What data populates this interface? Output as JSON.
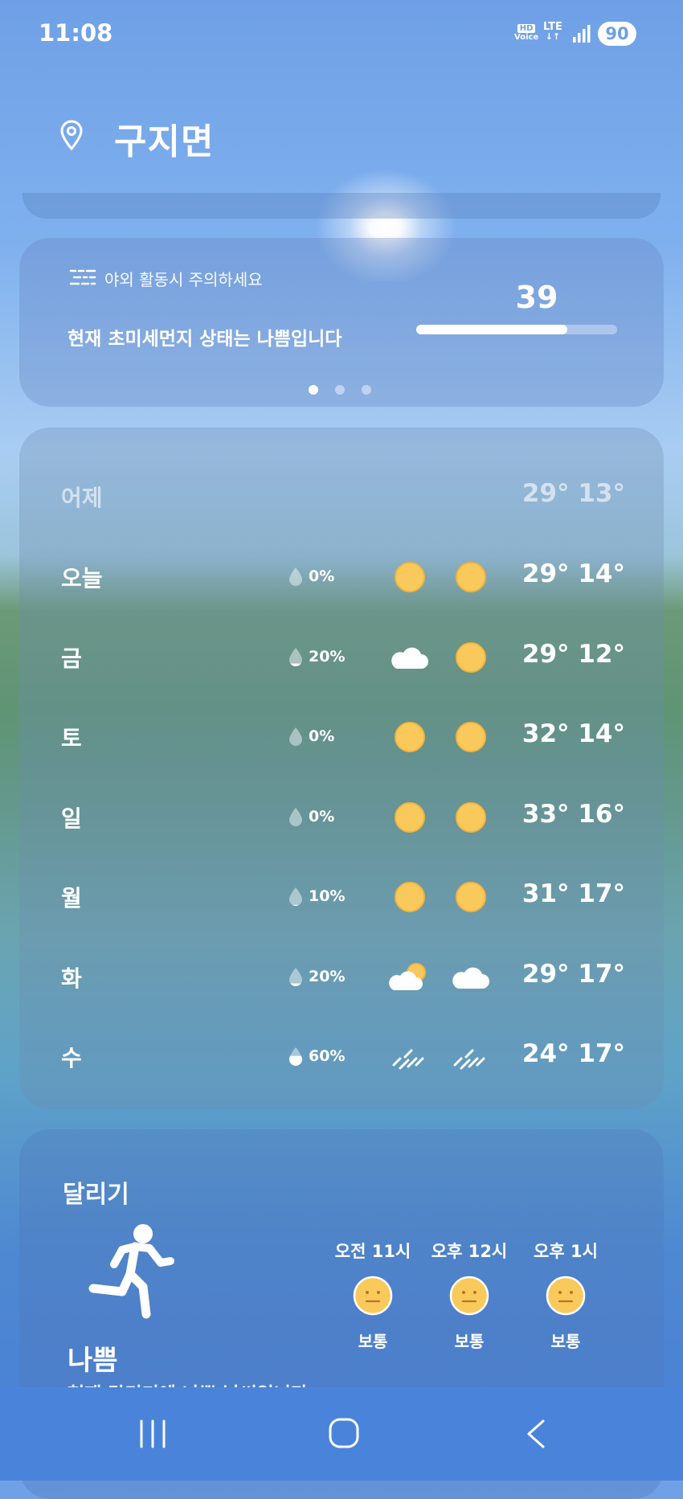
{
  "status_bar": {
    "time": "11:08",
    "hd_top": "HD",
    "hd_bottom": "Voice",
    "network": "LTE",
    "network_arrows": "↓↑",
    "battery": "90"
  },
  "location": {
    "name": "구지면",
    "icon": "location-pin-icon"
  },
  "air_quality": {
    "warning": "야외 활동시 주의하세요",
    "status": "현재 초미세먼지 상태는 나쁨입니다",
    "value": "39",
    "level_fraction": 0.75,
    "pages": 3,
    "active_page": 1
  },
  "forecast": {
    "yesterday": {
      "day": "어제",
      "temps": "29° 13°"
    },
    "days": [
      {
        "day": "오늘",
        "precip": "0%",
        "am": "sunny",
        "pm": "sunny",
        "temps": "29° 14°"
      },
      {
        "day": "금",
        "precip": "20%",
        "am": "cloudy",
        "pm": "sunny",
        "temps": "29° 12°"
      },
      {
        "day": "토",
        "precip": "0%",
        "am": "sunny",
        "pm": "sunny",
        "temps": "32° 14°"
      },
      {
        "day": "일",
        "precip": "0%",
        "am": "sunny",
        "pm": "sunny",
        "temps": "33° 16°"
      },
      {
        "day": "월",
        "precip": "10%",
        "am": "sunny",
        "pm": "sunny",
        "temps": "31° 17°"
      },
      {
        "day": "화",
        "precip": "20%",
        "am": "partly-cloudy",
        "pm": "cloudy",
        "temps": "29° 17°"
      },
      {
        "day": "수",
        "precip": "60%",
        "am": "rain",
        "pm": "rain",
        "temps": "24° 17°"
      }
    ]
  },
  "running": {
    "title": "달리기",
    "level": "나쁨",
    "description": "현재 달리기에 나쁜 날씨입니다",
    "hours": [
      {
        "label": "오전 11시",
        "status": "보통"
      },
      {
        "label": "오후 12시",
        "status": "보통"
      },
      {
        "label": "오후 1시",
        "status": "보통"
      }
    ]
  },
  "colors": {
    "sun": "#f9c95c",
    "sun_stroke": "#f2b43d",
    "nav_bar": "#4a84da"
  }
}
